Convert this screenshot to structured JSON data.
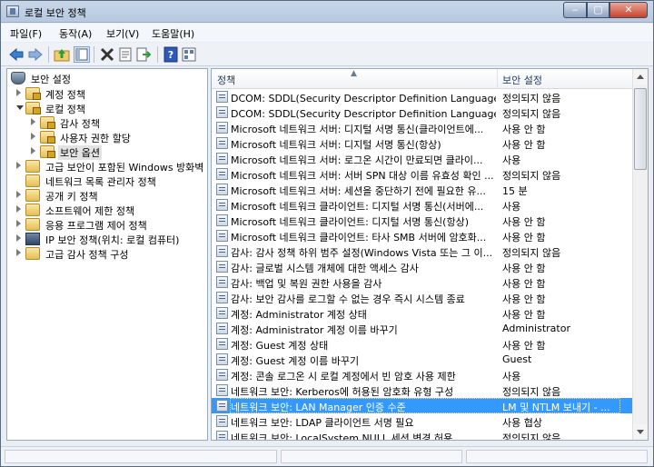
{
  "window": {
    "title": "로컬 보안 정책"
  },
  "menu": {
    "items": [
      "파일(F)",
      "동작(A)",
      "보기(V)",
      "도움말(H)"
    ]
  },
  "toolbar": {
    "buttons": [
      "back-arrow-icon",
      "forward-arrow-icon",
      "up-folder-icon",
      "show-tree-icon",
      "delete-icon",
      "properties-icon",
      "export-icon",
      "help-icon",
      "view-icon"
    ]
  },
  "tree": {
    "items": [
      {
        "label": "보안 설정",
        "level": 0,
        "expanded": true,
        "icon": "shield-icon"
      },
      {
        "label": "계정 정책",
        "level": 1,
        "expanded": false,
        "icon": "folder-icon"
      },
      {
        "label": "로컬 정책",
        "level": 1,
        "expanded": true,
        "icon": "folder-icon"
      },
      {
        "label": "감사 정책",
        "level": 2,
        "expanded": false,
        "icon": "folder-icon"
      },
      {
        "label": "사용자 권한 할당",
        "level": 2,
        "expanded": false,
        "icon": "folder-icon"
      },
      {
        "label": "보안 옵션",
        "level": 2,
        "expanded": false,
        "icon": "folder-icon",
        "selected": true
      },
      {
        "label": "고급 보안이 포함된 Windows 방화벽",
        "level": 1,
        "expanded": false,
        "icon": "folder-icon"
      },
      {
        "label": "네트워크 목록 관리자 정책",
        "level": 1,
        "expanded": null,
        "icon": "folder-icon"
      },
      {
        "label": "공개 키 정책",
        "level": 1,
        "expanded": false,
        "icon": "folder-icon"
      },
      {
        "label": "소프트웨어 제한 정책",
        "level": 1,
        "expanded": false,
        "icon": "folder-icon"
      },
      {
        "label": "응용 프로그램 제어 정책",
        "level": 1,
        "expanded": false,
        "icon": "folder-icon"
      },
      {
        "label": "IP 보안 정책(위치: 로컬 컴퓨터)",
        "level": 1,
        "expanded": false,
        "icon": "computer-icon"
      },
      {
        "label": "고급 감사 정책 구성",
        "level": 1,
        "expanded": false,
        "icon": "folder-icon"
      }
    ]
  },
  "list": {
    "columns": [
      "정책",
      "보안 설정"
    ],
    "rows": [
      {
        "policy": "DCOM: SDDL(Security Descriptor Definition Language) 구...",
        "setting": "정의되지 않음"
      },
      {
        "policy": "DCOM: SDDL(Security Descriptor Definition Language) 구...",
        "setting": "정의되지 않음"
      },
      {
        "policy": "Microsoft 네트워크 서버: 디지털 서명 통신(클라이언트에...",
        "setting": "사용 안 함"
      },
      {
        "policy": "Microsoft 네트워크 서버: 디지털 서명 통신(항상)",
        "setting": "사용 안 함"
      },
      {
        "policy": "Microsoft 네트워크 서버: 로그온 시간이 만료되면 클라이...",
        "setting": "사용"
      },
      {
        "policy": "Microsoft 네트워크 서버: 서버 SPN 대상 이름 유효성 확인 ...",
        "setting": "정의되지 않음"
      },
      {
        "policy": "Microsoft 네트워크 서버: 세션을 중단하기 전에 필요한 유...",
        "setting": "15 분"
      },
      {
        "policy": "Microsoft 네트워크 클라이언트: 디지털 서명 통신(서버에...",
        "setting": "사용"
      },
      {
        "policy": "Microsoft 네트워크 클라이언트: 디지털 서명 통신(항상)",
        "setting": "사용 안 함"
      },
      {
        "policy": "Microsoft 네트워크 클라이언트: 타사 SMB 서버에 암호화...",
        "setting": "사용 안 함"
      },
      {
        "policy": "감사: 감사 정책 하위 범주 설정(Windows Vista 또는 그 이...",
        "setting": "정의되지 않음"
      },
      {
        "policy": "감사: 글로벌 시스템 개체에 대한 액세스 감사",
        "setting": "사용 안 함"
      },
      {
        "policy": "감사: 백업 및 복원 권한 사용을 감사",
        "setting": "사용 안 함"
      },
      {
        "policy": "감사: 보안 감사를 로그할 수 없는 경우 즉시 시스템 종료",
        "setting": "사용 안 함"
      },
      {
        "policy": "계정: Administrator 계정 상태",
        "setting": "사용 안 함"
      },
      {
        "policy": "계정: Administrator 계정 이름 바꾸기",
        "setting": "Administrator"
      },
      {
        "policy": "계정: Guest 계정 상태",
        "setting": "사용 안 함"
      },
      {
        "policy": "계정: Guest 계정 이름 바꾸기",
        "setting": "Guest"
      },
      {
        "policy": "계정: 콘솔 로그온 시 로컬 계정에서 빈 암호 사용 제한",
        "setting": "사용"
      },
      {
        "policy": "네트워크 보안: Kerberos에 허용된 암호화 유형 구성",
        "setting": "정의되지 않음"
      },
      {
        "policy": "네트워크 보안: LAN Manager 인증 수준",
        "setting": "LM 및 NTLM 보내기 - ...",
        "selected": true
      },
      {
        "policy": "네트워크 보안: LDAP 클라이언트 서명 필요",
        "setting": "사용 협상"
      },
      {
        "policy": "네트워크 보안: LocalSystem NULL 세션 변경 허용",
        "setting": "정의되지 않음"
      }
    ]
  },
  "colors": {
    "selection": "#3399ff",
    "header_text": "#1e395b"
  }
}
